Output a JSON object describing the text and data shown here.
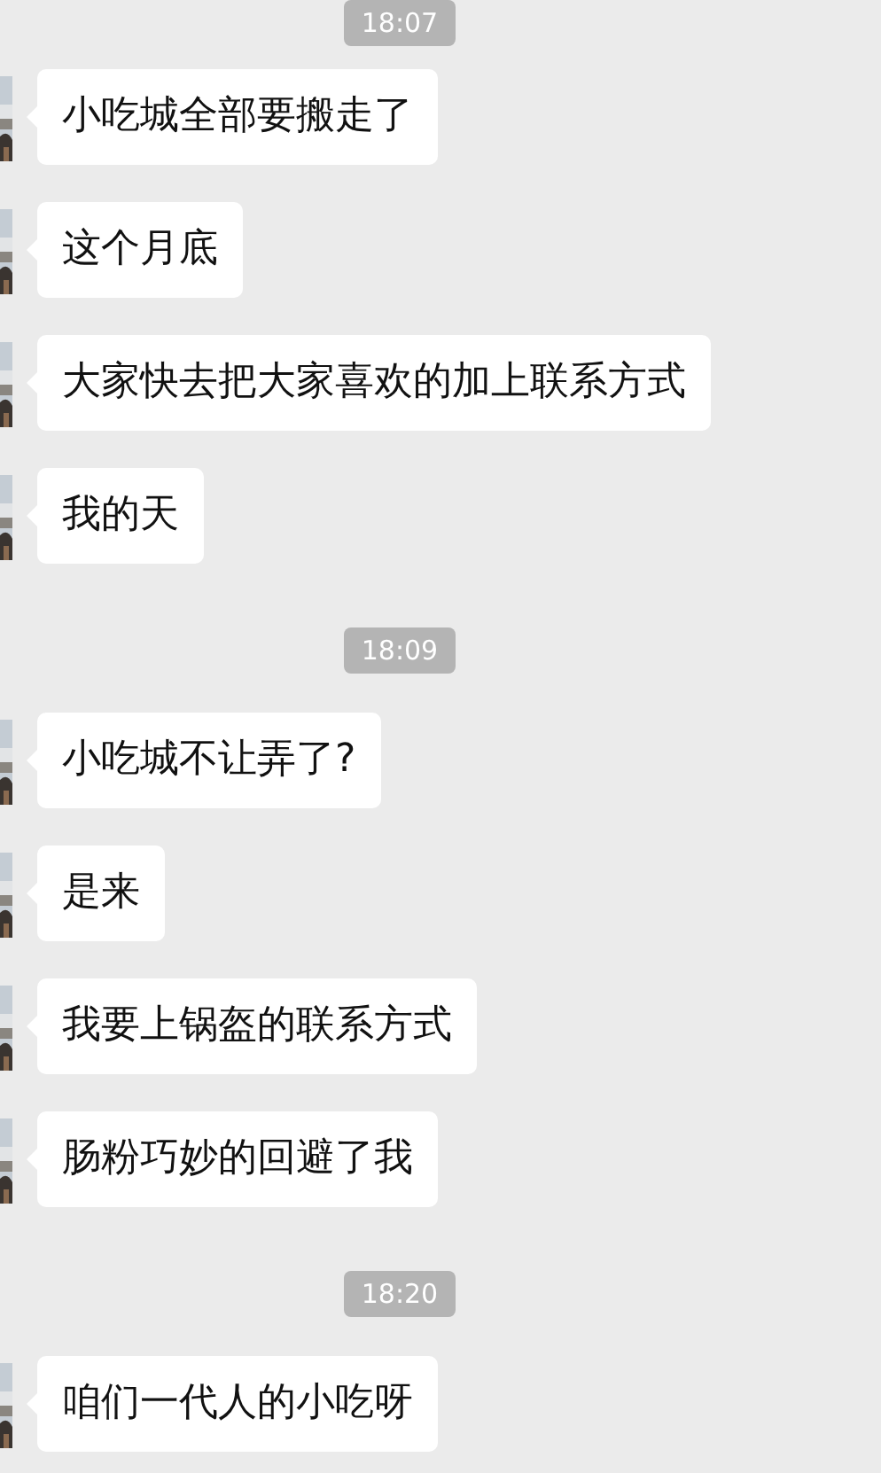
{
  "groups": [
    {
      "time": "18:07",
      "messages": [
        {
          "text": "小吃城全部要搬走了"
        },
        {
          "text": "这个月底"
        },
        {
          "text": "大家快去把大家喜欢的加上联系方式"
        },
        {
          "text": "我的天"
        }
      ]
    },
    {
      "time": "18:09",
      "messages": [
        {
          "text": "小吃城不让弄了?"
        },
        {
          "text": "是来"
        },
        {
          "text": "我要上锅盔的联系方式"
        },
        {
          "text": "肠粉巧妙的回避了我"
        }
      ]
    },
    {
      "time": "18:20",
      "messages": [
        {
          "text": "咱们一代人的小吃呀"
        }
      ]
    }
  ]
}
